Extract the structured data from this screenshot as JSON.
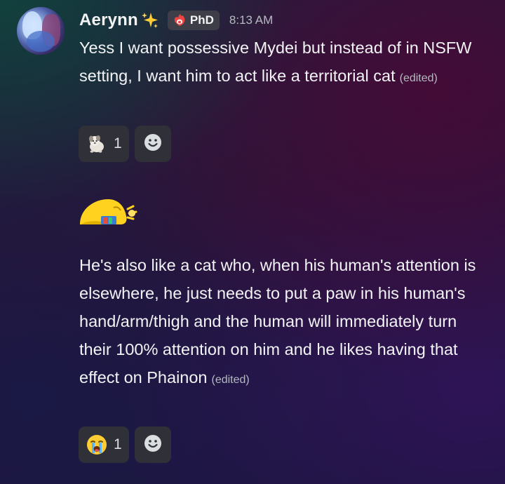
{
  "message": {
    "author": "Aerynn",
    "author_emoji_icon": "sparkles-icon",
    "role_badge": {
      "icon": "fire-heart-icon",
      "label": "PhD"
    },
    "timestamp": "8:13 AM",
    "first_text": "Yess I want possessive Mydei but instead of in NSFW setting, I want him to act like a territorial cat",
    "first_edited": "(edited)",
    "first_reactions": [
      {
        "emoji_icon": "dog-emoji-icon",
        "count": "1"
      }
    ],
    "sticker_icon": "yellow-blob-sleeping-sticker",
    "second_text": "He's also like a cat who, when his human's attention is elsewhere, he just needs to put a paw in his human's hand/arm/thigh and the human will immediately turn their 100% attention on him and he likes having that effect on Phainon",
    "second_edited": "(edited)",
    "second_reactions": [
      {
        "emoji_icon": "loudly-crying-face-icon",
        "count": "1"
      }
    ],
    "add_reaction_icon": "smiley-add-reaction-icon"
  },
  "colors": {
    "text": "#f2f3f5",
    "muted": "#b5bac1",
    "reaction_bg": "#2f3038",
    "badge_bg": "#3d3e47"
  }
}
